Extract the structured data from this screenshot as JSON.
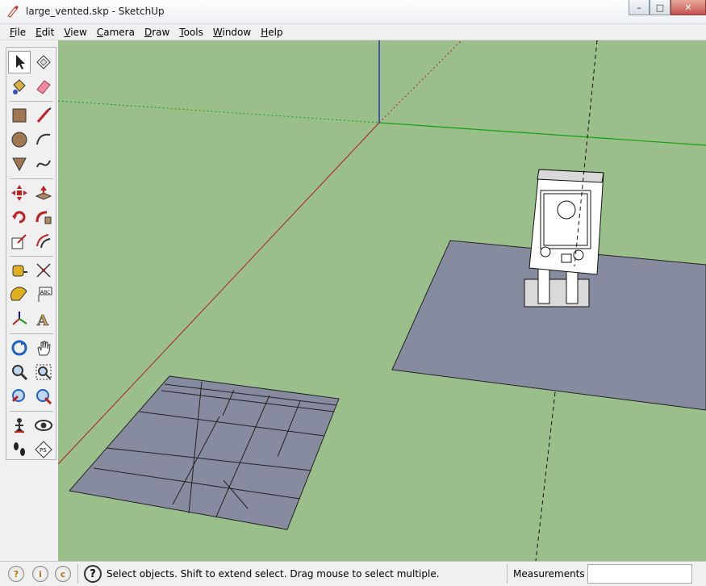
{
  "window": {
    "title": "large_vented.skp - SketchUp",
    "minimize": "–",
    "maximize": "□",
    "close": "✕"
  },
  "menu": [
    {
      "label": "File",
      "accel": "F",
      "rest": "ile"
    },
    {
      "label": "Edit",
      "accel": "E",
      "rest": "dit"
    },
    {
      "label": "View",
      "accel": "V",
      "rest": "iew"
    },
    {
      "label": "Camera",
      "accel": "C",
      "rest": "amera"
    },
    {
      "label": "Draw",
      "accel": "D",
      "rest": "raw"
    },
    {
      "label": "Tools",
      "accel": "T",
      "rest": "ools"
    },
    {
      "label": "Window",
      "accel": "W",
      "rest": "indow"
    },
    {
      "label": "Help",
      "accel": "H",
      "rest": "elp"
    }
  ],
  "tools": [
    "select-icon",
    "make-component-icon",
    "paint-bucket-icon",
    "eraser-icon",
    "rectangle-icon",
    "line-icon",
    "circle-icon",
    "arc-icon",
    "polygon-icon",
    "freehand-icon",
    "move-icon",
    "push-pull-icon",
    "rotate-icon",
    "follow-me-icon",
    "scale-icon",
    "offset-icon",
    "tape-measure-icon",
    "dimension-icon",
    "protractor-icon",
    "text-icon",
    "axes-icon",
    "3d-text-icon",
    "orbit-icon",
    "pan-icon",
    "zoom-icon",
    "zoom-window-icon",
    "previous-view-icon",
    "zoom-extents-icon",
    "position-camera-icon",
    "look-around-icon",
    "walk-icon",
    "section-plane-icon"
  ],
  "colors": {
    "ground": "#9bbf8b",
    "face": "#878ba0",
    "axis_red": "#b02020",
    "axis_green": "#10a010",
    "axis_blue": "#1010c0"
  },
  "status": {
    "icon1": "?",
    "icon2": "i",
    "icon3": "c",
    "help_glyph": "?",
    "message": "Select objects. Shift to extend select. Drag mouse to select multiple.",
    "measurements_label": "Measurements",
    "measurements_value": ""
  }
}
